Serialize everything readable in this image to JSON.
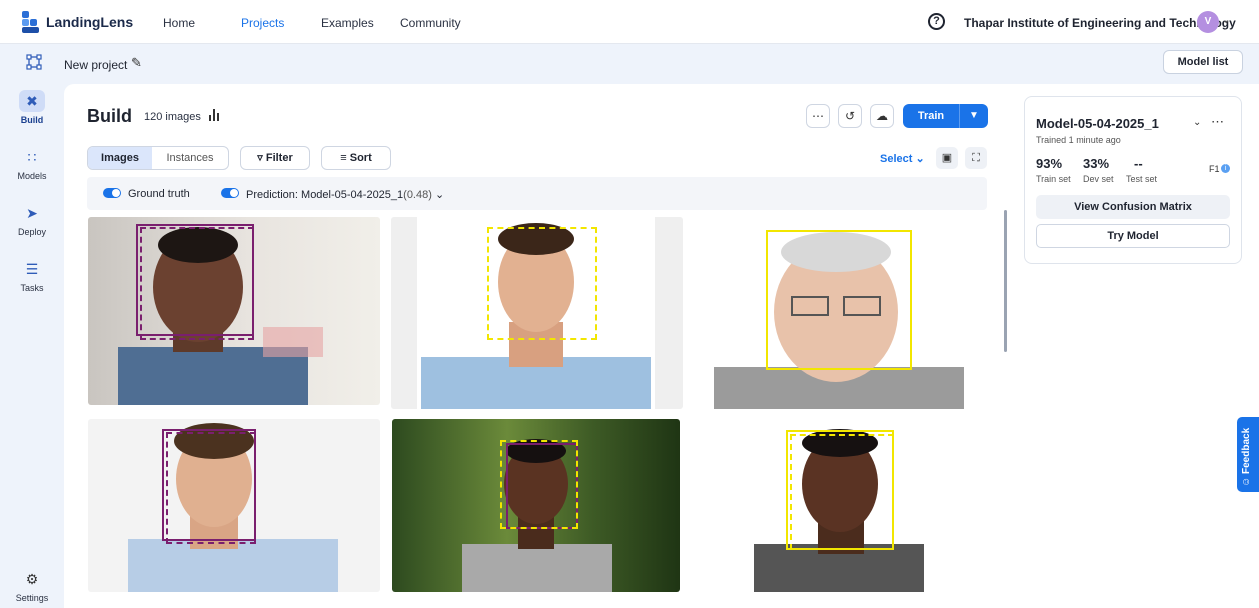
{
  "app": {
    "brand": "LandingLens",
    "nav": [
      "Home",
      "Projects",
      "Examples",
      "Community"
    ],
    "active_nav": "Projects",
    "help_glyph": "?",
    "org_name": "Thapar Institute of Engineering and Technology",
    "avatar_initial": "V"
  },
  "project": {
    "name": "New project",
    "model_list_label": "Model list"
  },
  "rail": {
    "build": "Build",
    "models": "Models",
    "deploy": "Deploy",
    "tasks": "Tasks",
    "settings": "Settings"
  },
  "build": {
    "title": "Build",
    "image_count": "120 images",
    "train_label": "Train",
    "tabs": {
      "images": "Images",
      "instances": "Instances"
    },
    "filter_label": "Filter",
    "sort_label": "Sort",
    "select_label": "Select",
    "ground_truth_label": "Ground truth",
    "prediction_label": "Prediction: Model-05-04-2025_1",
    "prediction_threshold": "(0.48)"
  },
  "model_card": {
    "name": "Model-05-04-2025_1",
    "trained": "Trained 1 minute ago",
    "metrics": [
      {
        "value": "93%",
        "label": "Train set"
      },
      {
        "value": "33%",
        "label": "Dev set"
      },
      {
        "value": "--",
        "label": "Test set"
      }
    ],
    "metric_name": "F1",
    "confusion_label": "View Confusion Matrix",
    "try_label": "Try Model"
  },
  "feedback_label": "Feedback",
  "colors": {
    "accent": "#1a73e8",
    "purple_class": "#7a1f6e",
    "yellow_class": "#f2e600"
  }
}
